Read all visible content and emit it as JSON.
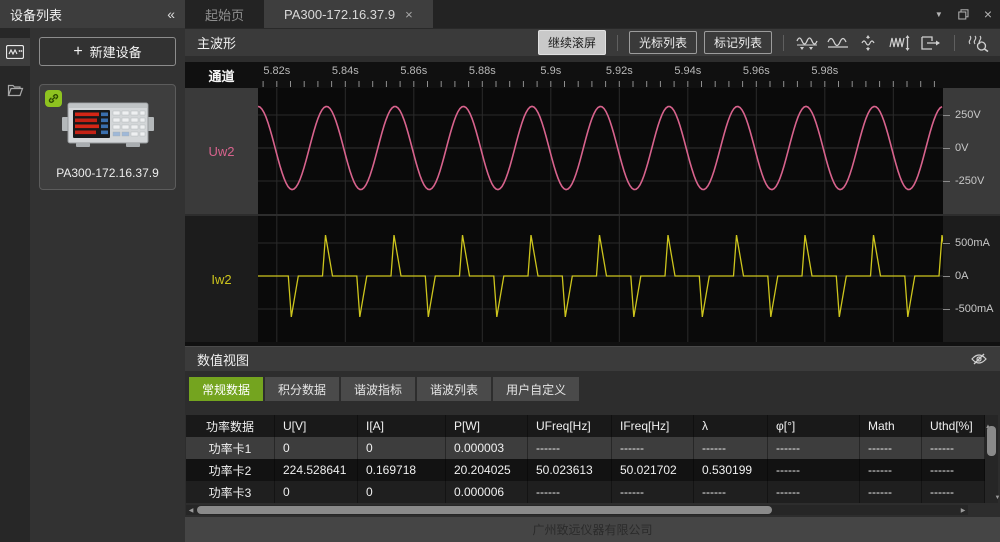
{
  "icons": {
    "collapse": "«",
    "plus": "+",
    "close": "×",
    "dropdown": "▼",
    "arrow_left": "◀",
    "arrow_right": "▶",
    "arrow_up": "▲",
    "arrow_down": "▼"
  },
  "sidebar": {
    "title": "设备列表",
    "new_device_label": "新建设备",
    "device_name": "PA300-172.16.37.9"
  },
  "tabs": [
    {
      "label": "起始页",
      "active": false
    },
    {
      "label": "PA300-172.16.37.9",
      "active": true,
      "closable": true
    }
  ],
  "toolbar": {
    "title": "主波形",
    "continue_scroll": "继续滚屏",
    "cursor_list": "光标列表",
    "marker_list": "标记列表"
  },
  "waveform": {
    "channel_header": "通道",
    "time_ticks": [
      "5.82s",
      "5.84s",
      "5.86s",
      "5.88s",
      "5.9s",
      "5.92s",
      "5.94s",
      "5.96s",
      "5.98s"
    ],
    "channels": [
      {
        "name": "Uw2",
        "color": "#d8638d",
        "selected": true,
        "scale": [
          "250V",
          "0V",
          "-250V"
        ]
      },
      {
        "name": "Iw2",
        "color": "#cdc51d",
        "selected": false,
        "scale": [
          "500mA",
          "0A",
          "-500mA"
        ]
      }
    ]
  },
  "chart_data": [
    {
      "type": "line",
      "name": "Uw2",
      "signal": "sine",
      "unit": "V",
      "color": "#d8638d",
      "frequency_hz": 50.02,
      "amplitude": 315,
      "y_ticks": [
        250,
        0,
        -250
      ],
      "y_tick_labels": [
        "250V",
        "0V",
        "-250V"
      ],
      "x_tick_labels": [
        "5.82s",
        "5.84s",
        "5.86s",
        "5.88s",
        "5.9s",
        "5.92s",
        "5.94s",
        "5.96s",
        "5.98s"
      ],
      "x_range_s": [
        5.8145,
        6.0145
      ],
      "grid": true,
      "legend_position": "left"
    },
    {
      "type": "line",
      "name": "Iw2",
      "signal": "spike-train",
      "unit": "mA",
      "color": "#cdc51d",
      "frequency_hz": 50.02,
      "baseline": 0,
      "spike_amplitude": 620,
      "y_ticks": [
        500,
        0,
        -500
      ],
      "y_tick_labels": [
        "500mA",
        "0A",
        "-500mA"
      ],
      "x_range_s": [
        5.8145,
        6.0145
      ],
      "grid": true,
      "legend_position": "left"
    }
  ],
  "numeric_view": {
    "title": "数值视图",
    "tabs": [
      {
        "label": "常规数据",
        "active": true
      },
      {
        "label": "积分数据",
        "active": false
      },
      {
        "label": "谐波指标",
        "active": false
      },
      {
        "label": "谐波列表",
        "active": false
      },
      {
        "label": "用户自定义",
        "active": false
      }
    ],
    "table": {
      "columns": [
        "功率数据",
        "U[V]",
        "I[A]",
        "P[W]",
        "UFreq[Hz]",
        "IFreq[Hz]",
        "λ",
        "φ[°]",
        "Math",
        "Uthd[%]"
      ],
      "rows": [
        {
          "selected": true,
          "cells": [
            "功率卡1",
            "0",
            "0",
            "0.000003",
            "------",
            "------",
            "------",
            "------",
            "------",
            "------"
          ]
        },
        {
          "selected": false,
          "cells": [
            "功率卡2",
            "224.528641",
            "0.169718",
            "20.204025",
            "50.023613",
            "50.021702",
            "0.530199",
            "------",
            "------",
            "------"
          ]
        },
        {
          "selected": false,
          "cells": [
            "功率卡3",
            "0",
            "0",
            "0.000006",
            "------",
            "------",
            "------",
            "------",
            "------",
            "------"
          ]
        }
      ]
    }
  },
  "footer": "广州致远仪器有限公司"
}
